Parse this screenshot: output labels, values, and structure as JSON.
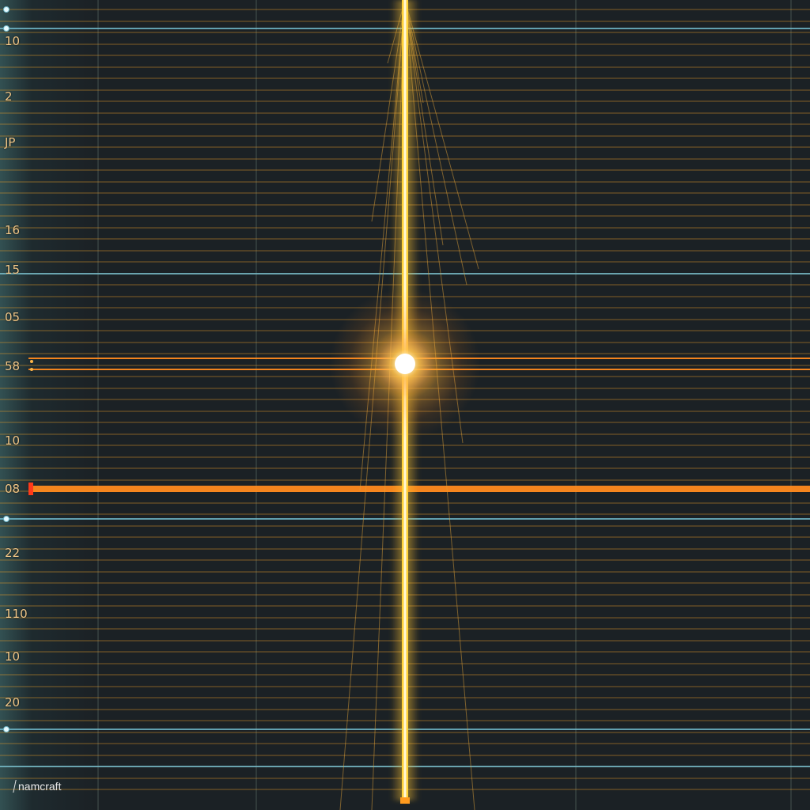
{
  "labels": [
    {
      "text": "10"
    },
    {
      "text": "2"
    },
    {
      "text": "JP"
    },
    {
      "text": "16"
    },
    {
      "text": "15"
    },
    {
      "text": "05"
    },
    {
      "text": "58"
    },
    {
      "text": "10"
    },
    {
      "text": "08"
    },
    {
      "text": "22"
    },
    {
      "text": "110"
    },
    {
      "text": "10"
    },
    {
      "text": "20"
    }
  ],
  "brand": {
    "text": "namcraft"
  },
  "colors": {
    "background": "#1b2125",
    "grid_orange": "#d9952a",
    "grid_blue": "#6fb6c8",
    "highlight_orange": "#ff8a1e",
    "beam": "#ffd23a",
    "label": "#f1c788"
  }
}
